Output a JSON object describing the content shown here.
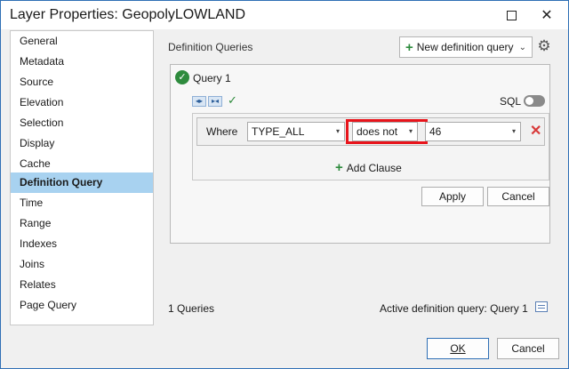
{
  "window": {
    "title": "Layer Properties: GeopolyLOWLAND",
    "border_color": "#2f6fb5"
  },
  "sidebar": {
    "items": [
      {
        "label": "General"
      },
      {
        "label": "Metadata"
      },
      {
        "label": "Source"
      },
      {
        "label": "Elevation"
      },
      {
        "label": "Selection"
      },
      {
        "label": "Display"
      },
      {
        "label": "Cache"
      },
      {
        "label": "Definition Query",
        "active": true
      },
      {
        "label": "Time"
      },
      {
        "label": "Range"
      },
      {
        "label": "Indexes"
      },
      {
        "label": "Joins"
      },
      {
        "label": "Relates"
      },
      {
        "label": "Page Query"
      }
    ],
    "active_color": "#a8d2f0"
  },
  "content": {
    "section_title": "Definition Queries",
    "new_query_label": "New definition query",
    "query": {
      "name": "Query 1",
      "sql_label": "SQL",
      "where_label": "Where",
      "field": "TYPE_ALL",
      "operator": "does not",
      "value": "46",
      "add_clause_label": "Add Clause",
      "apply_label": "Apply",
      "cancel_label": "Cancel"
    },
    "status": {
      "count": "1 Queries",
      "active": "Active definition query: Query 1"
    },
    "highlight_color": "#e8141b"
  },
  "footer": {
    "ok_label": "OK",
    "cancel_label": "Cancel"
  }
}
